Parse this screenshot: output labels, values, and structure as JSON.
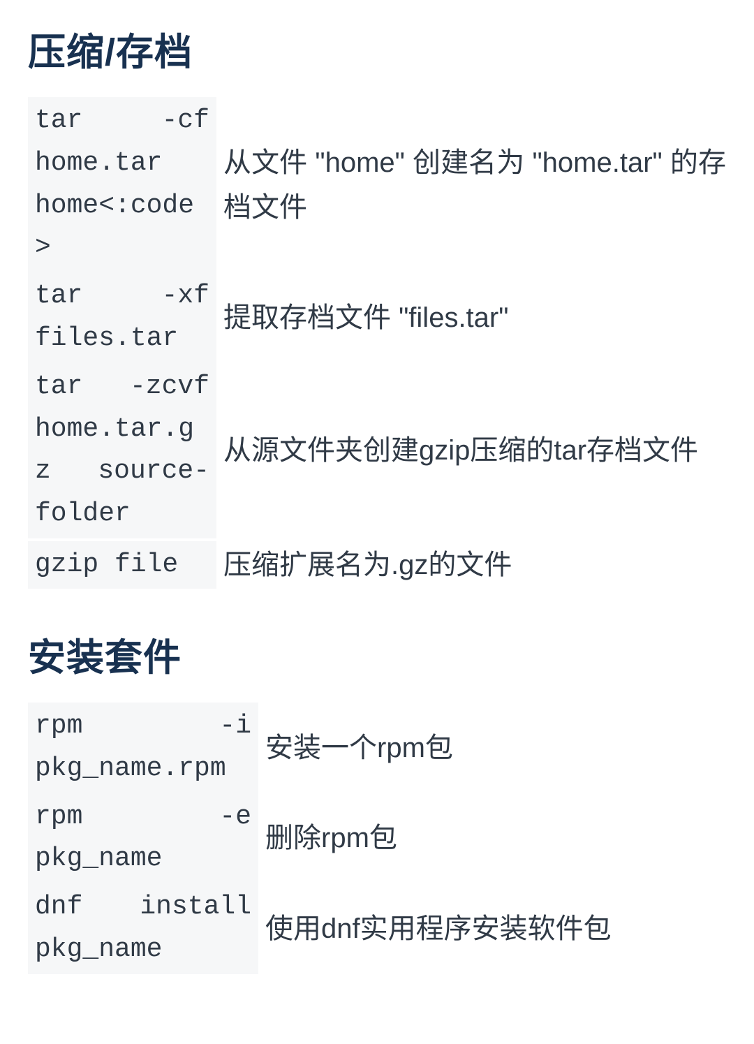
{
  "sections": [
    {
      "heading": "压缩/存档",
      "rows": [
        {
          "cmd": "tar -cf home.tar home<:code>",
          "desc": "从文件 \"home\" 创建名为 \"home.tar\" 的存档文件"
        },
        {
          "cmd": "tar -xf files.tar",
          "desc": "提取存档文件 \"files.tar\""
        },
        {
          "cmd": "tar -zcvf home.tar.gz source-folder",
          "desc": "从源文件夹创建gzip压缩的tar存档文件"
        },
        {
          "cmd": "gzip file",
          "desc": "压缩扩展名为.gz的文件"
        }
      ]
    },
    {
      "heading": "安装套件",
      "rows": [
        {
          "cmd": "rpm -i pkg_name.rpm",
          "desc": "安装一个rpm包"
        },
        {
          "cmd": "rpm -e pkg_name",
          "desc": "删除rpm包"
        },
        {
          "cmd": "dnf install pkg_name",
          "desc": "使用dnf实用程序安装软件包"
        }
      ]
    }
  ]
}
